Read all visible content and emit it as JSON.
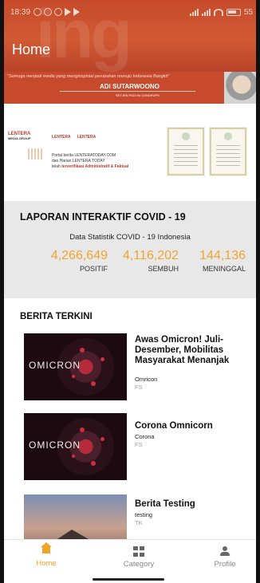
{
  "status_bar": {
    "time": "18:39",
    "battery": "55"
  },
  "app_bar": {
    "title": "Home"
  },
  "banner1": {
    "tagline": "\"Semoga menjadi media yang menginspirasi perubahan menuju Indonesia Bangkit\"",
    "name": "ADI SUTARWOONO",
    "role": "SETJEN PKDI IN CONDRUPS"
  },
  "banner2": {
    "media_group": "LENTERA",
    "media_group_sub": "MEDIA GROUP",
    "logo_left": "LENTERA",
    "logo_right": "LENTERA",
    "line1": "Portal berita LENTERATODAY.COM",
    "line2": "dan Harian LENTERA TODAY",
    "line3_prefix": "telah",
    "line3_bold": "terverifikasi Administratif & Faktual"
  },
  "covid": {
    "title": "LAPORAN INTERAKTIF COVID - 19",
    "subtitle": "Data Statistik COVID - 19 Indonesia",
    "positif_value": "4,266,649",
    "positif_label": "POSITIF",
    "sembuh_value": "4,116,202",
    "sembuh_label": "SEMBUH",
    "meninggal_value": "144,136",
    "meninggal_label": "MENINGGAL",
    "accent_color": "#f0a52c"
  },
  "berita": {
    "title": "BERITA TERKINI",
    "items": [
      {
        "title": "Awas Omicron! Juli-Desember, Mobilitas Masyarakat Menanjak",
        "category": "Omricon",
        "author": "FS",
        "thumb_word": "OMICRON"
      },
      {
        "title": "Corona Omnicorn",
        "category": "Corona",
        "author": "FS",
        "thumb_word": "OMICRON"
      },
      {
        "title": "Berita Testing",
        "category": "testing",
        "author": "TK"
      }
    ]
  },
  "bottom_nav": {
    "items": [
      {
        "label": "Home",
        "icon": "home-icon",
        "active": true
      },
      {
        "label": "Category",
        "icon": "category-icon",
        "active": false
      },
      {
        "label": "Profile",
        "icon": "profile-icon",
        "active": false
      }
    ]
  }
}
